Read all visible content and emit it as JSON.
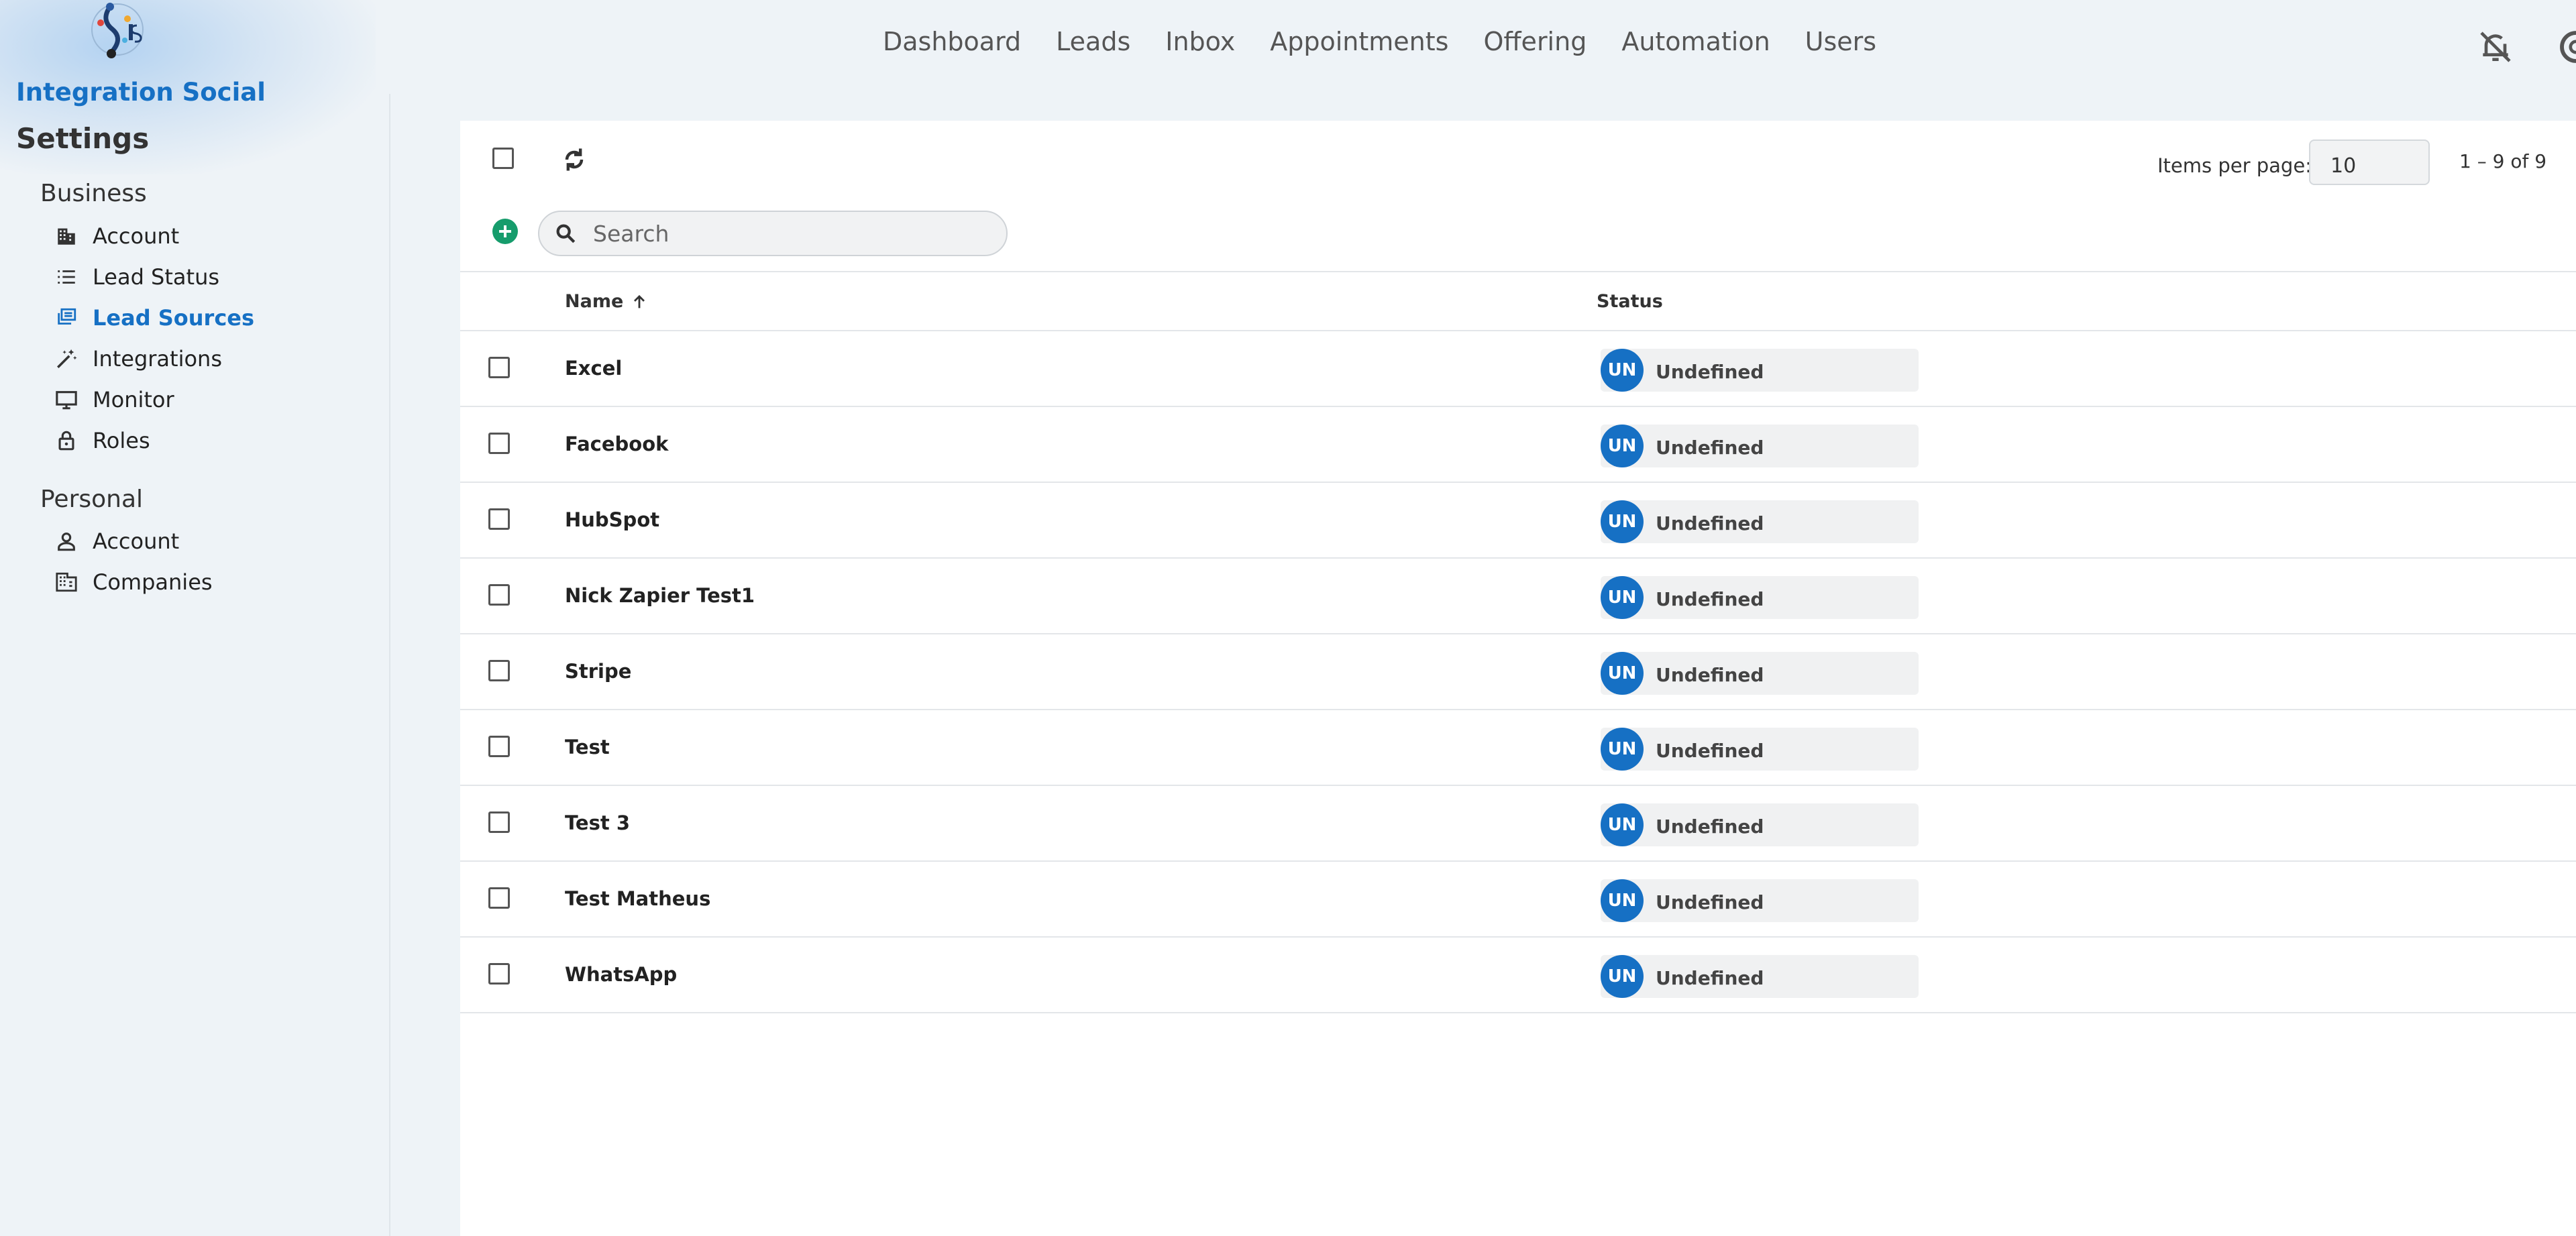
{
  "brand": {
    "name": "Integration Social"
  },
  "topnav": {
    "items": [
      "Dashboard",
      "Leads",
      "Inbox",
      "Appointments",
      "Offering",
      "Automation",
      "Users"
    ]
  },
  "sidebar": {
    "title": "Settings",
    "business_label": "Business",
    "business_items": [
      {
        "label": "Account",
        "icon": "building-icon"
      },
      {
        "label": "Lead Status",
        "icon": "list-icon"
      },
      {
        "label": "Lead Sources",
        "icon": "library-icon",
        "active": true
      },
      {
        "label": "Integrations",
        "icon": "magic-wand-icon"
      },
      {
        "label": "Monitor",
        "icon": "monitor-icon"
      },
      {
        "label": "Roles",
        "icon": "lock-icon"
      }
    ],
    "personal_label": "Personal",
    "personal_items": [
      {
        "label": "Account",
        "icon": "person-icon"
      },
      {
        "label": "Companies",
        "icon": "companies-icon"
      }
    ]
  },
  "toolbar": {
    "items_per_page_label": "Items per page:",
    "items_per_page_value": "10",
    "range": "1 – 9 of 9",
    "search_placeholder": "Search"
  },
  "table": {
    "columns": [
      "Name",
      "Status"
    ],
    "sort": "Name ascending",
    "rows": [
      {
        "name": "Excel",
        "status": "Undefined",
        "badge": "UN"
      },
      {
        "name": "Facebook",
        "status": "Undefined",
        "badge": "UN"
      },
      {
        "name": "HubSpot",
        "status": "Undefined",
        "badge": "UN"
      },
      {
        "name": "Nick Zapier Test1",
        "status": "Undefined",
        "badge": "UN"
      },
      {
        "name": "Stripe",
        "status": "Undefined",
        "badge": "UN"
      },
      {
        "name": "Test",
        "status": "Undefined",
        "badge": "UN"
      },
      {
        "name": "Test 3",
        "status": "Undefined",
        "badge": "UN"
      },
      {
        "name": "Test Matheus",
        "status": "Undefined",
        "badge": "UN"
      },
      {
        "name": "WhatsApp",
        "status": "Undefined",
        "badge": "UN"
      }
    ]
  },
  "colors": {
    "accent": "#1670c4",
    "add_button": "#169c6c",
    "background": "#eef3f7"
  }
}
